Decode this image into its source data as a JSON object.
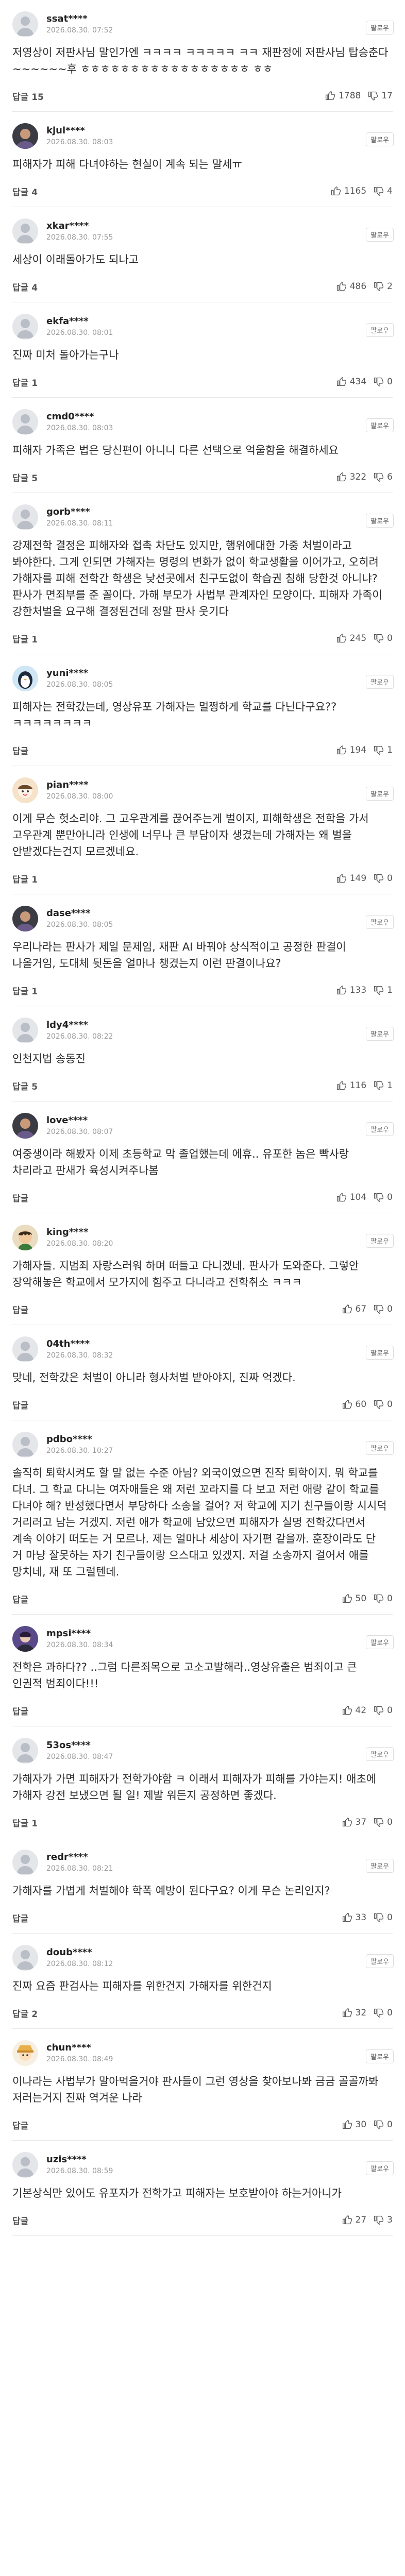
{
  "ui": {
    "follow_label": "팔로우"
  },
  "comments": [
    {
      "nick": "ssat****",
      "date": "2026.08.30. 07:52",
      "text": "저영상이 저판사님 말인가엔 ㅋㅋㅋㅋ ㅋㅋㅋㅋㅋ ㅋㅋ 재판정에 저판사님 탑승춘다 ~~~~~~후 ㅎㅎㅎㅎㅎㅎㅎㅎㅎㅎㅎㅎㅎㅎㅎㅎㅎ ㅎㅎ",
      "reply": "답글 15",
      "likes": "1788",
      "dislikes": "17",
      "avatar": "avatar-gray"
    },
    {
      "nick": "kjul****",
      "date": "2026.08.30. 08:03",
      "text": "피해자가 피해 다녀야하는 현실이 계속 되는 말세ㅠ",
      "reply": "답글 4",
      "likes": "1165",
      "dislikes": "4",
      "avatar": "avatar-dark"
    },
    {
      "nick": "xkar****",
      "date": "2026.08.30. 07:55",
      "text": "세상이 이래돌아가도 되나고",
      "reply": "답글 4",
      "likes": "486",
      "dislikes": "2",
      "avatar": "avatar-gray"
    },
    {
      "nick": "ekfa****",
      "date": "2026.08.30. 08:01",
      "text": "진짜 미처 돌아가는구나",
      "reply": "답글 1",
      "likes": "434",
      "dislikes": "0",
      "avatar": "avatar-gray"
    },
    {
      "nick": "cmd0****",
      "date": "2026.08.30. 08:03",
      "text": "피해자 가족은 법은 당신편이 아니니 다른 선택으로 억울함을 해결하세요",
      "reply": "답글 5",
      "likes": "322",
      "dislikes": "6",
      "avatar": "avatar-gray"
    },
    {
      "nick": "gorb****",
      "date": "2026.08.30. 08:11",
      "text": "강제전학 결정은 피해자와 접촉 차단도 있지만, 행위에대한 가중 처벌이라고 봐야한다. 그게 인되면 가해자는 명령의 변화가 없이 학교생활을 이어가고, 오히려 가해자를 피해 전학간 학생은 낮선곳에서 친구도없이 학습권 침해 당한것 아니냐? 판사가 면죄부를 준 꼴이다. 가해 부모가 사법부 관계자인 모양이다. 피해자 가족이 강한처벌을 요구해 결정된건데 정말 판사 웃기다",
      "reply": "답글 1",
      "likes": "245",
      "dislikes": "0",
      "avatar": "avatar-gray"
    },
    {
      "nick": "yuni****",
      "date": "2026.08.30. 08:05",
      "text": "피해자는 전학갔는데, 영상유포 가해자는 멀쩡하게 학교를 다닌다구요??ㅋㅋㅋㅋㅋㅋㅋㅋ",
      "reply": "답글",
      "likes": "194",
      "dislikes": "1",
      "avatar": "avatar-penguin"
    },
    {
      "nick": "pian****",
      "date": "2026.08.30. 08:00",
      "text": "이게 무슨 헛소리야. 그 고우관계를 끊어주는게 벌이지, 피해학생은 전학을 가서 고우관계 뿐만아니라 인생에 너무나 큰 부담이자 생겼는데 가해자는 왜 벌을 안받겠다는건지 모르겠네요.",
      "reply": "답글 1",
      "likes": "149",
      "dislikes": "0",
      "avatar": "avatar-character"
    },
    {
      "nick": "dase****",
      "date": "2026.08.30. 08:05",
      "text": "우리나라는 판사가 제일 문제임, 재판 AI 바꿔야 상식적이고 공정한 판결이 나올거임, 도대체 뒷돈을 얼마나 챙겼는지 이런 판결이나요?",
      "reply": "답글 1",
      "likes": "133",
      "dislikes": "1",
      "avatar": "avatar-dark"
    },
    {
      "nick": "ldy4****",
      "date": "2026.08.30. 08:22",
      "text": "인천지법 송동진",
      "reply": "답글 5",
      "likes": "116",
      "dislikes": "1",
      "avatar": "avatar-gray"
    },
    {
      "nick": "love****",
      "date": "2026.08.30. 08:07",
      "text": "여중생이라 해봤자 이제 초등학교 막 졸업했는데 에휴.. 유포한 놈은 빡사랑 차리라고 판새가 육성시켜주나봄",
      "reply": "답글",
      "likes": "104",
      "dislikes": "0",
      "avatar": "avatar-dark"
    },
    {
      "nick": "king****",
      "date": "2026.08.30. 08:20",
      "text": "가해자들. 지범죄 자랑스러워 하며 떠들고 다니겠네. 판사가 도와준다. 그렇안 장악해놓은 학교에서 모가지에 힘주고 다니라고 전학취소 ㅋㅋㅋ",
      "reply": "답글",
      "likes": "67",
      "dislikes": "0",
      "avatar": "avatar-cartoon"
    },
    {
      "nick": "04th****",
      "date": "2026.08.30. 08:32",
      "text": "맞네, 전학갔은 처벌이 아니라 형사처벌 받아야지, 진짜 억겠다.",
      "reply": "답글",
      "likes": "60",
      "dislikes": "0",
      "avatar": "avatar-gray"
    },
    {
      "nick": "pdbo****",
      "date": "2026.08.30. 10:27",
      "text": "솔직히 퇴학시켜도 할 말 없는 수준 아님? 외국이였으면 진작 퇴학이지. 뭐 학교를 다녀. 그 학교 다니는 여자애들은 왜 저런 꼬라지를 다 보고 저런 애랑 같이 학교를 다녀야 해? 반성했다면서 부당하다 소송을 걸어? 저 학교에 지기 친구들이랑 시시덕 거리러고 남는 거겠지. 저런 애가 학교에 남았으면 피해자가 실명 전학갔다면서 계속 이야기 떠도는 거 모르나. 제는 얼마나 세상이 자기편 같을까. 훈장이라도 단 거 마냥 잘못하는 자기 친구들이랑 으스대고 있겠지. 저걸 소송까지 걸어서 애를 망치네, 재 또 그럴텐데.",
      "reply": "답글",
      "likes": "50",
      "dislikes": "0",
      "avatar": "avatar-gray"
    },
    {
      "nick": "mpsi****",
      "date": "2026.08.30. 08:34",
      "text": "전학은 과하다?? ..그럼 다른죄목으로 고소고발해라..영상유출은 범죄이고 큰 인권적 범죄이다!!!",
      "reply": "답글",
      "likes": "42",
      "dislikes": "0",
      "avatar": "avatar-purple"
    },
    {
      "nick": "53os****",
      "date": "2026.08.30. 08:47",
      "text": "가해자가 가면 피해자가 전학가야함 ㅋ 이래서 피해자가 피해를 가야는지! 애초에 가해자 강전 보냈으면 될 일! 제발 워든지 공정하면 좋겠다.",
      "reply": "답글 1",
      "likes": "37",
      "dislikes": "0",
      "avatar": "avatar-gray"
    },
    {
      "nick": "redr****",
      "date": "2026.08.30. 08:21",
      "text": "가해자를 가볍게 처벌해야 학폭 예방이 된다구요? 이게 무슨 논리인지?",
      "reply": "답글",
      "likes": "33",
      "dislikes": "0",
      "avatar": "avatar-gray"
    },
    {
      "nick": "doub****",
      "date": "2026.08.30. 08:12",
      "text": "진짜 요즘 판검사는 피해자를 위한건지 가해자를 위한건지",
      "reply": "답글 2",
      "likes": "32",
      "dislikes": "0",
      "avatar": "avatar-gray"
    },
    {
      "nick": "chun****",
      "date": "2026.08.30. 08:49",
      "text": "이나라는 사법부가 말아먹을거야 판사들이 그런 영상을 찾아보나봐 금금 골골까봐 저러는거지 진짜 역겨운 나라",
      "reply": "답글",
      "likes": "30",
      "dislikes": "0",
      "avatar": "avatar-hat"
    },
    {
      "nick": "uzis****",
      "date": "2026.08.30. 08:59",
      "text": "기본상식만 있어도 유포자가 전학가고 피해자는 보호받아야 하는거아니가",
      "reply": "답글",
      "likes": "27",
      "dislikes": "3",
      "avatar": "avatar-gray"
    }
  ]
}
